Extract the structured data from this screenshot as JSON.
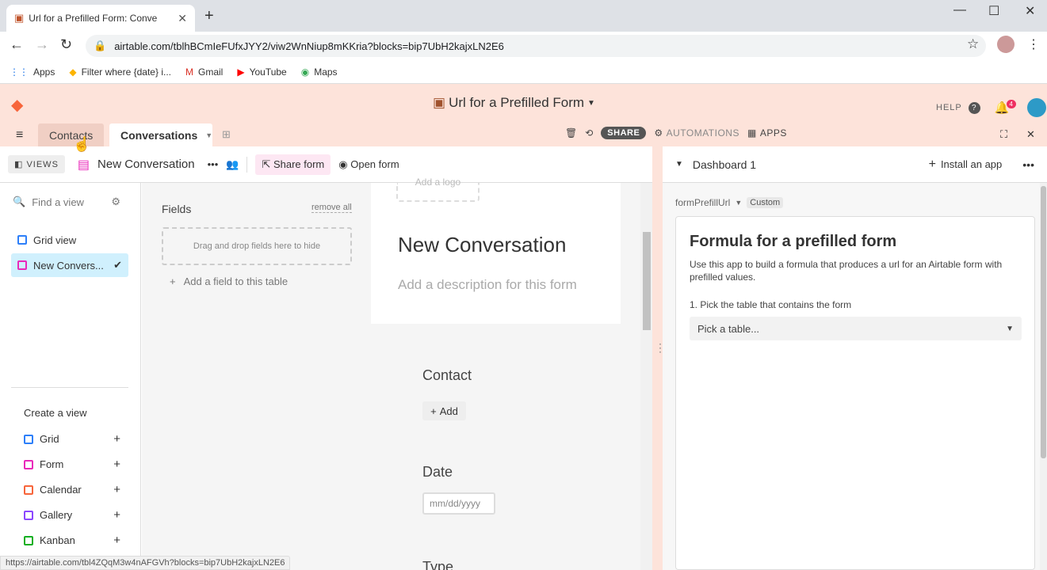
{
  "browser": {
    "tab_title": "Url for a Prefilled Form: Conve",
    "url": "airtable.com/tblhBCmIeFUfxJYY2/viw2WnNiup8mKKria?blocks=bip7UbH2kajxLN2E6",
    "bookmarks": [
      {
        "label": "Apps"
      },
      {
        "label": "Filter where {date} i..."
      },
      {
        "label": "Gmail"
      },
      {
        "label": "YouTube"
      },
      {
        "label": "Maps"
      }
    ],
    "status_url": "https://airtable.com/tbl4ZQqM3w4nAFGVh?blocks=bip7UbH2kajxLN2E6"
  },
  "base": {
    "name": "Url for a Prefilled Form",
    "help": "HELP",
    "notification_count": "4",
    "tabs": [
      "Contacts",
      "Conversations"
    ],
    "tools": {
      "share": "SHARE",
      "automations": "AUTOMATIONS",
      "apps": "APPS"
    }
  },
  "viewbar": {
    "views": "VIEWS",
    "view_name": "New Conversation",
    "share_form": "Share form",
    "open_form": "Open form"
  },
  "sidebar": {
    "find_placeholder": "Find a view",
    "views": [
      {
        "label": "Grid view"
      },
      {
        "label": "New Convers..."
      }
    ],
    "create_view": "Create a view",
    "create_items": [
      {
        "label": "Grid",
        "color": "#2d7ff9"
      },
      {
        "label": "Form",
        "color": "#e929ba"
      },
      {
        "label": "Calendar",
        "color": "#f7653b"
      },
      {
        "label": "Gallery",
        "color": "#8b46ff"
      },
      {
        "label": "Kanban",
        "color": "#11af22"
      }
    ]
  },
  "fields_panel": {
    "title": "Fields",
    "remove_all": "remove all",
    "drop_hint": "Drag and drop fields here to hide",
    "add_field": "Add a field to this table"
  },
  "form": {
    "logo_hint": "Add a logo",
    "title": "New Conversation",
    "description": "Add a description for this form",
    "fields": {
      "contact": "Contact",
      "add": "Add",
      "date": "Date",
      "date_placeholder": "mm/dd/yyyy",
      "type": "Type"
    }
  },
  "dashboard": {
    "title": "Dashboard 1",
    "install_app": "Install an app",
    "app_name": "formPrefillUrl",
    "app_badge": "Custom",
    "app_title": "Formula for a prefilled form",
    "app_desc": "Use this app to build a formula that produces a url for an Airtable form with prefilled values.",
    "step1": "1. Pick the table that contains the form",
    "pick_table": "Pick a table..."
  },
  "colors": {
    "header_bg": "#fde3da",
    "active_view_bg": "#d0f0fd"
  }
}
